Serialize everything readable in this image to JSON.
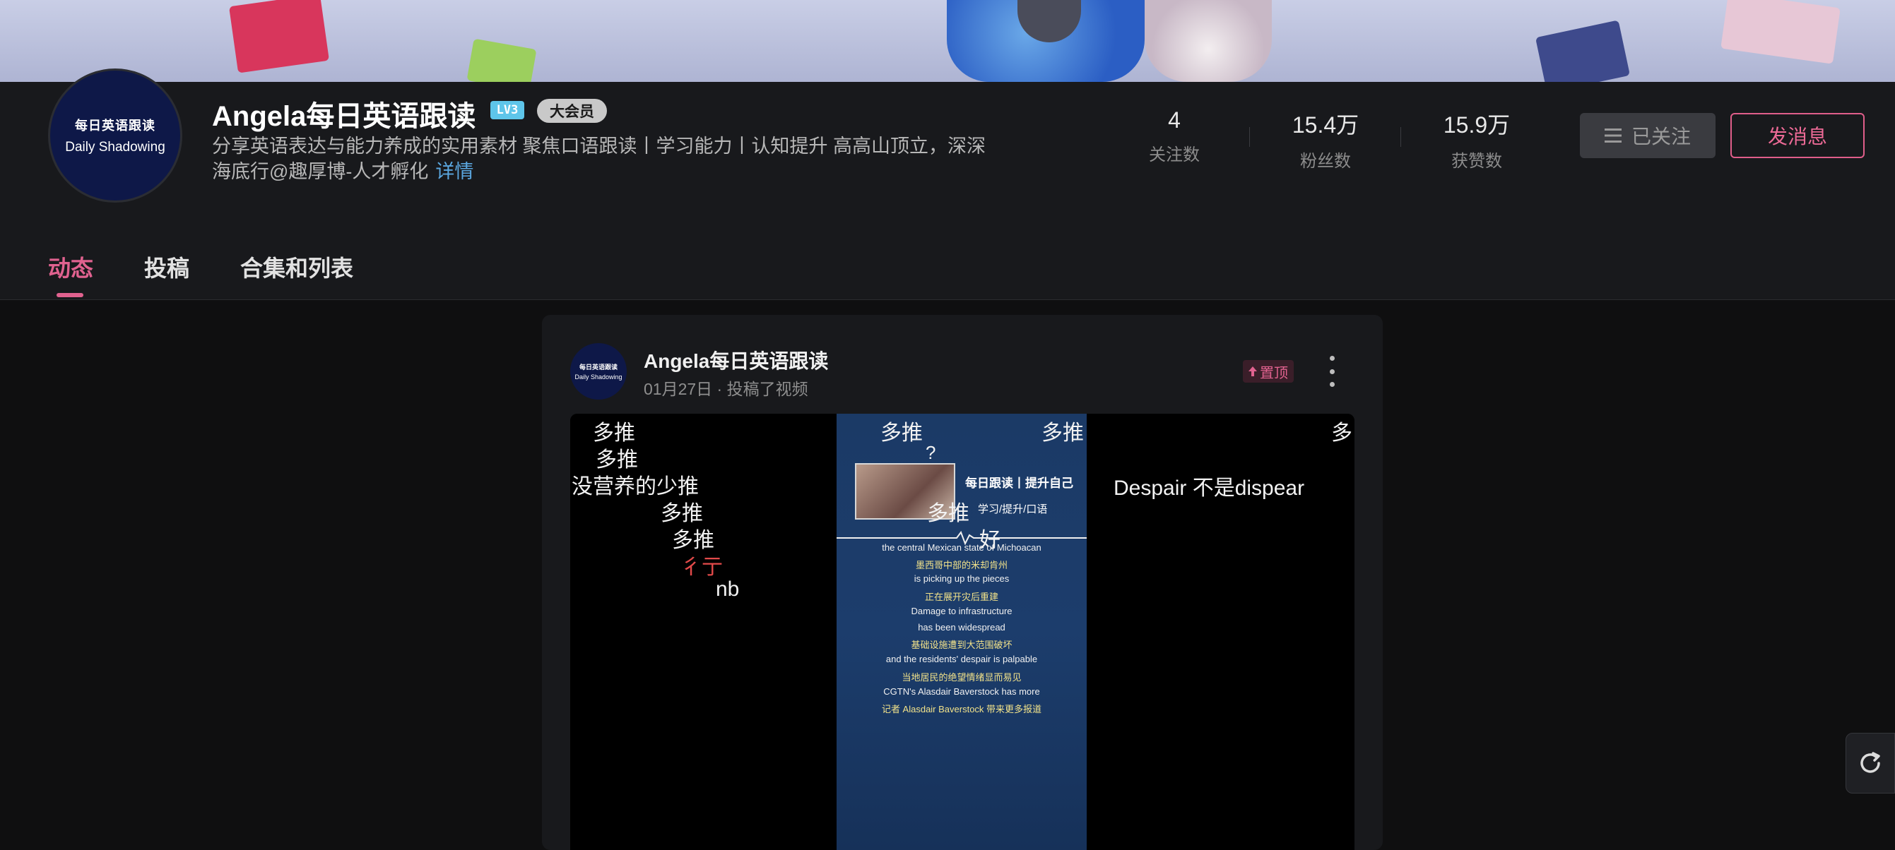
{
  "profile": {
    "name": "Angela每日英语跟读",
    "level_badge": "LV3",
    "vip_badge": "大会员",
    "avatar_line1": "每日英语跟读",
    "avatar_line2": "Daily Shadowing",
    "bio_line1": "分享英语表达与能力养成的实用素材 聚焦口语跟读丨学习能力丨认知提升 高高山顶立，深深",
    "bio_line2": "海底行@趣厚博-人才孵化",
    "bio_more": "详情"
  },
  "stats": [
    {
      "value": "4",
      "label": "关注数"
    },
    {
      "value": "15.4万",
      "label": "粉丝数"
    },
    {
      "value": "15.9万",
      "label": "获赞数"
    }
  ],
  "actions": {
    "followed_label": "已关注",
    "message_label": "发消息"
  },
  "tabs": [
    {
      "label": "动态",
      "active": true
    },
    {
      "label": "投稿",
      "active": false
    },
    {
      "label": "合集和列表",
      "active": false
    }
  ],
  "post": {
    "author": "Angela每日英语跟读",
    "date": "01月27日",
    "action": "投稿了视频",
    "pinned_label": "置顶",
    "avatar_line1": "每日英语跟读",
    "avatar_line2": "Daily Shadowing",
    "left_danmaku": [
      "多推",
      "多推",
      "没营养的少推",
      "多推",
      "多推",
      "彳亍",
      "nb"
    ],
    "mid_danmaku": [
      "多推",
      "多推",
      "?",
      "多推",
      "好"
    ],
    "mid_title": "每日跟读丨提升自己",
    "mid_subtitle": "学习/提升/口语",
    "subtitles": [
      "the central Mexican state of Michoacan",
      "墨西哥中部的米却肯州",
      "is picking up the pieces",
      "正在展开灾后重建",
      "Damage to infrastructure",
      "has been widespread",
      "基础设施遭到大范围破坏",
      "and the residents' despair is palpable",
      "当地居民的绝望情绪显而易见",
      "CGTN's Alasdair Baverstock has more",
      "记者 Alasdair Baverstock 带来更多报道"
    ],
    "right_danmaku": [
      "Despair 不是dispear",
      "多"
    ]
  },
  "colors": {
    "accent": "#e0628f",
    "link": "#5ba7e0",
    "background": "#0f0f10",
    "panel": "#18191c"
  }
}
